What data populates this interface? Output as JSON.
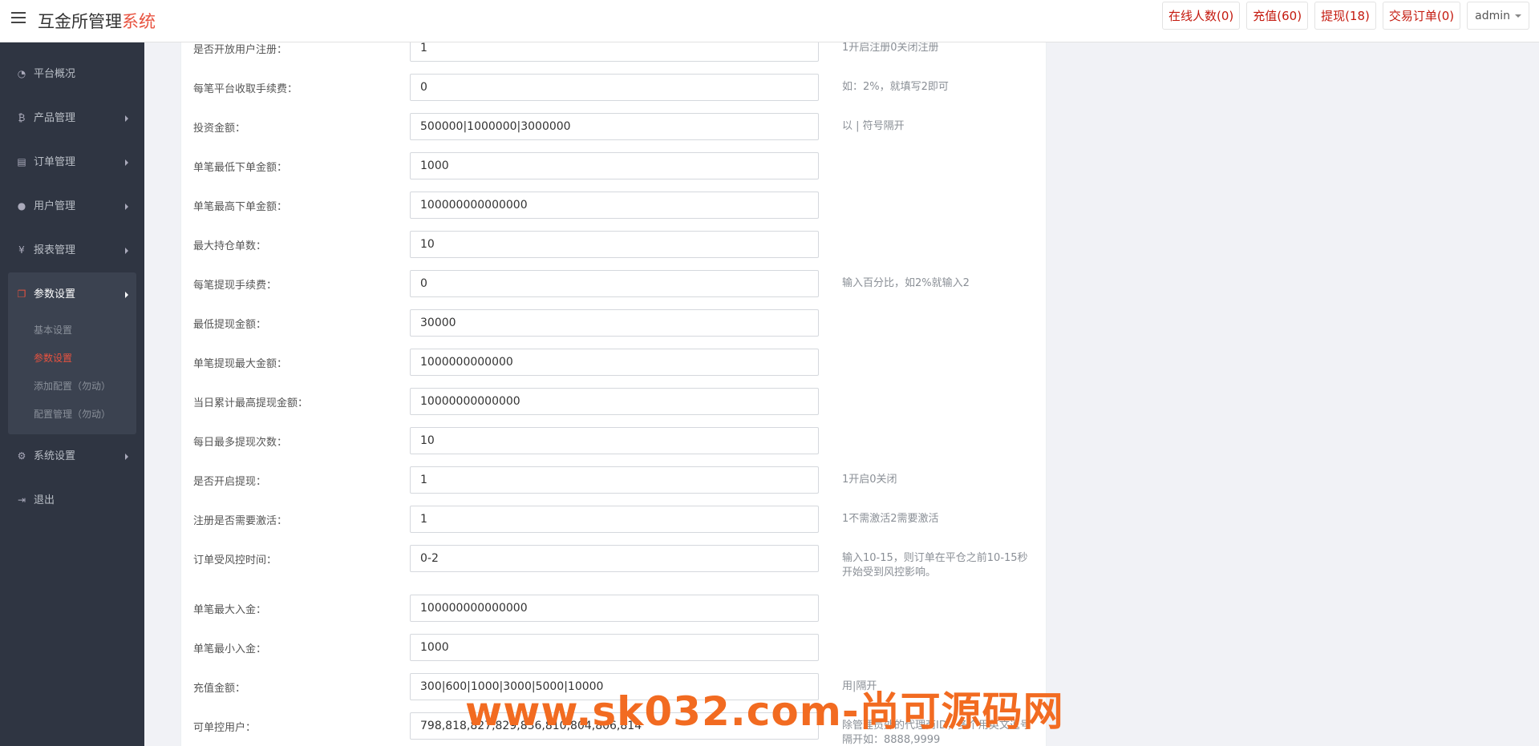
{
  "header": {
    "brand_main": "互金所管理",
    "brand_accent": "系统",
    "actions": [
      "在线人数(0)",
      "充值(60)",
      "提现(18)",
      "交易订单(0)"
    ],
    "user": "admin"
  },
  "sidebar": {
    "items": [
      {
        "label": "平台概况",
        "icon": "dashboard-icon"
      },
      {
        "label": "产品管理",
        "icon": "bitcoin-icon"
      },
      {
        "label": "订单管理",
        "icon": "document-icon"
      },
      {
        "label": "用户管理",
        "icon": "user-icon"
      },
      {
        "label": "报表管理",
        "icon": "yen-icon"
      }
    ],
    "active_group": {
      "label": "参数设置",
      "icon": "copy-icon"
    },
    "sub_items": [
      "基本设置",
      "参数设置",
      "添加配置（勿动）",
      "配置管理（勿动）"
    ],
    "bottom_items": [
      {
        "label": "系统设置",
        "icon": "cogs-icon"
      },
      {
        "label": "退出",
        "icon": "sign-out-icon"
      }
    ]
  },
  "form": {
    "rows": [
      {
        "label": "是否开放用户注册：",
        "value": "1",
        "help": "1开启注册0关闭注册"
      },
      {
        "label": "每笔平台收取手续费：",
        "value": "0",
        "help": "如：2%，就填写2即可"
      },
      {
        "label": "投资金额：",
        "value": "500000|1000000|3000000",
        "help": "以 | 符号隔开"
      },
      {
        "label": "单笔最低下单金额：",
        "value": "1000",
        "help": ""
      },
      {
        "label": "单笔最高下单金额：",
        "value": "100000000000000",
        "help": ""
      },
      {
        "label": "最大持仓单数：",
        "value": "10",
        "help": ""
      },
      {
        "label": "每笔提现手续费：",
        "value": "0",
        "help": "输入百分比，如2%就输入2"
      },
      {
        "label": "最低提现金额：",
        "value": "30000",
        "help": ""
      },
      {
        "label": "单笔提现最大金额：",
        "value": "1000000000000",
        "help": ""
      },
      {
        "label": "当日累计最高提现金额：",
        "value": "10000000000000",
        "help": ""
      },
      {
        "label": "每日最多提现次数：",
        "value": "10",
        "help": ""
      },
      {
        "label": "是否开启提现：",
        "value": "1",
        "help": "1开启0关闭"
      },
      {
        "label": "注册是否需要激活：",
        "value": "1",
        "help": "1不需激活2需要激活"
      },
      {
        "label": "订单受风控时间：",
        "value": "0-2",
        "help": "输入10-15，则订单在平仓之前10-15秒开始受到风控影响。"
      },
      {
        "label": "单笔最大入金：",
        "value": "100000000000000",
        "help": ""
      },
      {
        "label": "单笔最小入金：",
        "value": "1000",
        "help": ""
      },
      {
        "label": "充值金额：",
        "value": "300|600|1000|3000|5000|10000",
        "help": "用|隔开"
      },
      {
        "label": "可单控用户：",
        "value": "798,818,827,829,836,810,804,806,814",
        "help": "除管理员外的代理商ID，多个用英文逗号隔开如：8888,9999"
      }
    ]
  },
  "watermark": "www.sk032.com-尚可源码网"
}
